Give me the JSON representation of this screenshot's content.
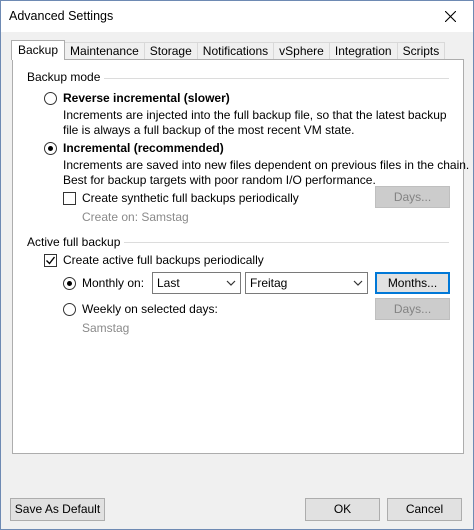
{
  "window": {
    "title": "Advanced Settings"
  },
  "tabs": [
    {
      "label": "Backup",
      "active": true
    },
    {
      "label": "Maintenance"
    },
    {
      "label": "Storage"
    },
    {
      "label": "Notifications"
    },
    {
      "label": "vSphere"
    },
    {
      "label": "Integration"
    },
    {
      "label": "Scripts"
    }
  ],
  "backup_mode": {
    "group_label": "Backup mode",
    "reverse_incremental": {
      "label": "Reverse incremental (slower)",
      "selected": false,
      "desc_line1": "Increments are injected into the full backup file, so that the latest backup",
      "desc_line2": "file is always a full backup of the most recent VM state."
    },
    "incremental": {
      "label": "Incremental (recommended)",
      "selected": true,
      "desc_line1": "Increments are saved into new files dependent on previous files in the chain.",
      "desc_line2": "Best for backup targets with poor random I/O performance."
    },
    "synthetic": {
      "label": "Create synthetic full backups periodically",
      "checked": false,
      "days_button": "Days...",
      "create_on": "Create on:  Samstag"
    }
  },
  "active_full": {
    "group_label": "Active full backup",
    "create_periodically": {
      "label": "Create active full backups periodically",
      "checked": true
    },
    "monthly": {
      "label": "Monthly on:",
      "selected": true,
      "week_value": "Last",
      "day_value": "Freitag",
      "months_button": "Months..."
    },
    "weekly": {
      "label": "Weekly on selected days:",
      "selected": false,
      "days_button": "Days...",
      "days_value": "Samstag"
    }
  },
  "footer": {
    "save_default": "Save As Default",
    "ok": "OK",
    "cancel": "Cancel"
  }
}
